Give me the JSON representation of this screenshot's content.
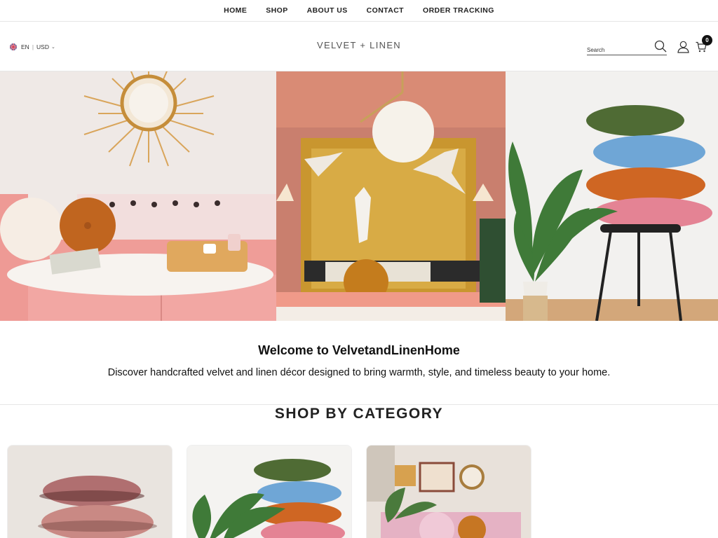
{
  "nav": {
    "items": [
      "HOME",
      "SHOP",
      "ABOUT US",
      "CONTACT",
      "ORDER TRACKING"
    ]
  },
  "header": {
    "language": "EN",
    "currency": "USD",
    "brand": "VELVET + LINEN",
    "search_placeholder": "Search",
    "cart_count": "0"
  },
  "hero": {
    "panels": [
      "living-room-pink-sofa",
      "bedroom-gold-headboard",
      "stacked-velvet-cushions"
    ]
  },
  "welcome": {
    "title": "Welcome to VelvetandLinenHome",
    "text": "Discover handcrafted velvet and linen décor designed to bring warmth, style, and timeless beauty to your home."
  },
  "categories": {
    "title": "SHOP BY CATEGORY",
    "cards": [
      "fringed-velvet-cushions",
      "stacked-colorful-cushions",
      "boho-room-decor"
    ]
  },
  "icons": {
    "search": "search-icon",
    "account": "user-icon",
    "cart": "cart-icon",
    "flag": "uk-flag-icon",
    "dropdown": "chevron-down-icon"
  },
  "colors": {
    "text": "#1c1c1c",
    "border": "#e6e6e6",
    "badge": "#111111"
  }
}
